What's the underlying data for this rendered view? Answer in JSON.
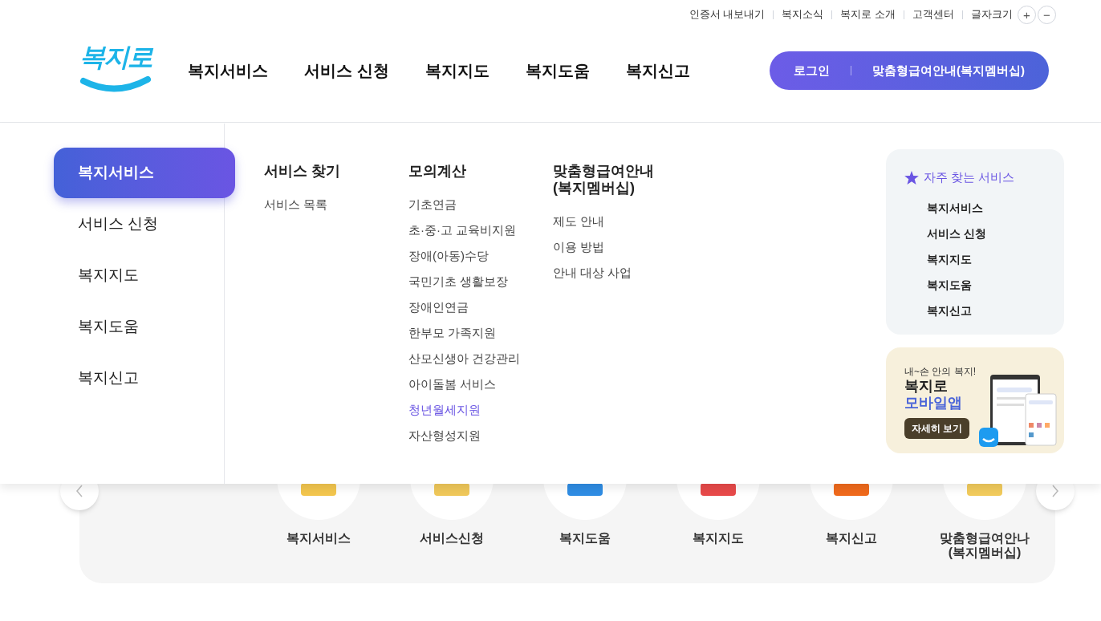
{
  "utility_links": [
    "인증서 내보내기",
    "복지소식",
    "복지로 소개",
    "고객센터"
  ],
  "font_size": {
    "label": "글자크기",
    "buttons": [
      "+",
      "−"
    ]
  },
  "logo": "복지로",
  "nav": [
    "복지서비스",
    "서비스 신청",
    "복지지도",
    "복지도움",
    "복지신고"
  ],
  "header_buttons": [
    "로그인",
    "맞춤형급여안내(복지멤버십)"
  ],
  "menu": {
    "sidebar": [
      {
        "label": "복지서비스",
        "selected": true
      },
      {
        "label": "서비스 신청",
        "selected": false
      },
      {
        "label": "복지지도",
        "selected": false
      },
      {
        "label": "복지도움",
        "selected": false
      },
      {
        "label": "복지신고",
        "selected": false
      }
    ],
    "columns": [
      {
        "heading": "서비스 찾기",
        "items": [
          {
            "label": "서비스 목록",
            "selected": false
          }
        ]
      },
      {
        "heading": "모의계산",
        "items": [
          {
            "label": "기초연금",
            "selected": false
          },
          {
            "label": "초·중·고 교육비지원",
            "selected": false
          },
          {
            "label": "장애(아동)수당",
            "selected": false
          },
          {
            "label": "국민기초 생활보장",
            "selected": false
          },
          {
            "label": "장애인연금",
            "selected": false
          },
          {
            "label": "한부모 가족지원",
            "selected": false
          },
          {
            "label": "산모신생아 건강관리",
            "selected": false
          },
          {
            "label": "아이돌봄 서비스",
            "selected": false
          },
          {
            "label": "청년월세지원",
            "selected": true
          },
          {
            "label": "자산형성지원",
            "selected": false
          }
        ]
      },
      {
        "heading": "맞춤형급여안내\n(복지멤버십)",
        "items": [
          {
            "label": "제도 안내",
            "selected": false
          },
          {
            "label": "이용 방법",
            "selected": false
          },
          {
            "label": "안내 대상 사업",
            "selected": false
          }
        ]
      }
    ]
  },
  "favorites": {
    "title": "자주 찾는 서비스",
    "items": [
      "복지서비스",
      "서비스 신청",
      "복지지도",
      "복지도움",
      "복지신고"
    ]
  },
  "app_banner": {
    "tagline": "내~손 안의 복지!",
    "title": "복지로",
    "highlight": "모바일앱",
    "button": "자세히 보기"
  },
  "quick_services": [
    {
      "label": "복지서비스",
      "color": "#f3c64e"
    },
    {
      "label": "서비스신청",
      "color": "#f0c85a"
    },
    {
      "label": "복지도움",
      "color": "#2f8de4"
    },
    {
      "label": "복지지도",
      "color": "#e84a4a"
    },
    {
      "label": "복지신고",
      "color": "#f06a1c"
    },
    {
      "label": "맞춤형급여안나\n(복지멤버십)",
      "color": "#f2cb5c"
    }
  ]
}
